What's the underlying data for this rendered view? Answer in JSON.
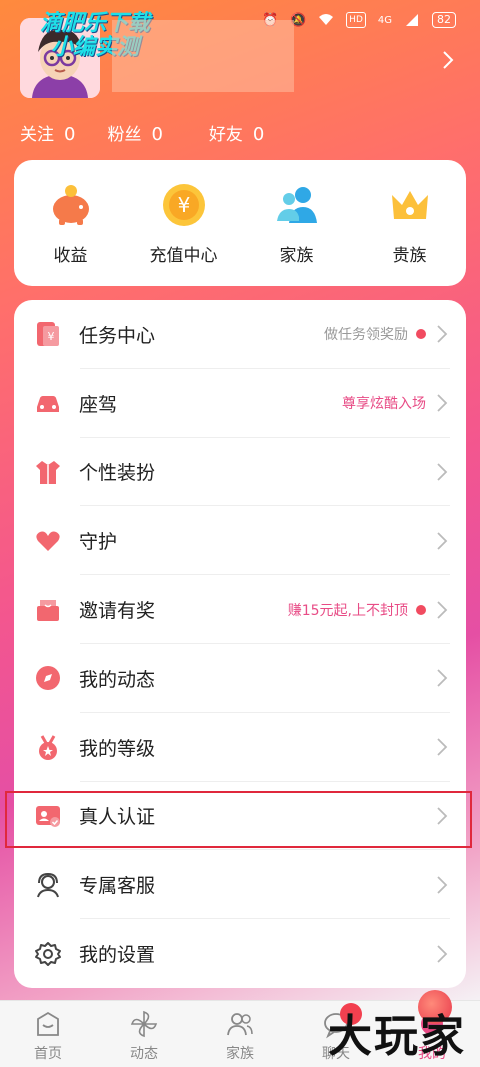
{
  "status_bar": {
    "battery": "82",
    "network": "4G",
    "hd": "HD"
  },
  "overlay": {
    "line1": "滴肥乐下载",
    "line2": "小编实测"
  },
  "profile": {
    "stats": [
      {
        "label": "关注",
        "value": "0"
      },
      {
        "label": "粉丝",
        "value": "0"
      },
      {
        "label": "好友",
        "value": "0"
      }
    ]
  },
  "quick_actions": [
    {
      "label": "收益",
      "icon": "piggy-bank-icon"
    },
    {
      "label": "充值中心",
      "icon": "yuan-coin-icon"
    },
    {
      "label": "家族",
      "icon": "family-icon"
    },
    {
      "label": "贵族",
      "icon": "crown-icon"
    }
  ],
  "menu": [
    {
      "label": "任务中心",
      "hint": "做任务领奖励",
      "dot": true,
      "icon": "task-icon"
    },
    {
      "label": "座驾",
      "hint": "尊享炫酷入场",
      "dot": false,
      "icon": "car-icon"
    },
    {
      "label": "个性装扮",
      "hint": "",
      "dot": false,
      "icon": "outfit-icon"
    },
    {
      "label": "守护",
      "hint": "",
      "dot": false,
      "icon": "heart-hand-icon"
    },
    {
      "label": "邀请有奖",
      "hint": "赚15元起,上不封顶",
      "dot": true,
      "icon": "gift-mail-icon"
    },
    {
      "label": "我的动态",
      "hint": "",
      "dot": false,
      "icon": "compass-icon"
    },
    {
      "label": "我的等级",
      "hint": "",
      "dot": false,
      "icon": "medal-icon"
    },
    {
      "label": "真人认证",
      "hint": "",
      "dot": false,
      "icon": "id-verify-icon"
    },
    {
      "label": "专属客服",
      "hint": "",
      "dot": false,
      "icon": "headset-icon"
    },
    {
      "label": "我的设置",
      "hint": "",
      "dot": false,
      "icon": "gear-icon"
    }
  ],
  "tabs": [
    {
      "label": "首页",
      "icon": "home-icon"
    },
    {
      "label": "动态",
      "icon": "pinwheel-icon"
    },
    {
      "label": "家族",
      "icon": "family-tab-icon"
    },
    {
      "label": "聊天",
      "icon": "chat-icon"
    },
    {
      "label": "我的",
      "icon": "me-icon"
    }
  ],
  "watermark": "大玩家",
  "colors": {
    "accent": "#e94a85",
    "dot": "#f14b60",
    "highlight": "#e0283c"
  }
}
